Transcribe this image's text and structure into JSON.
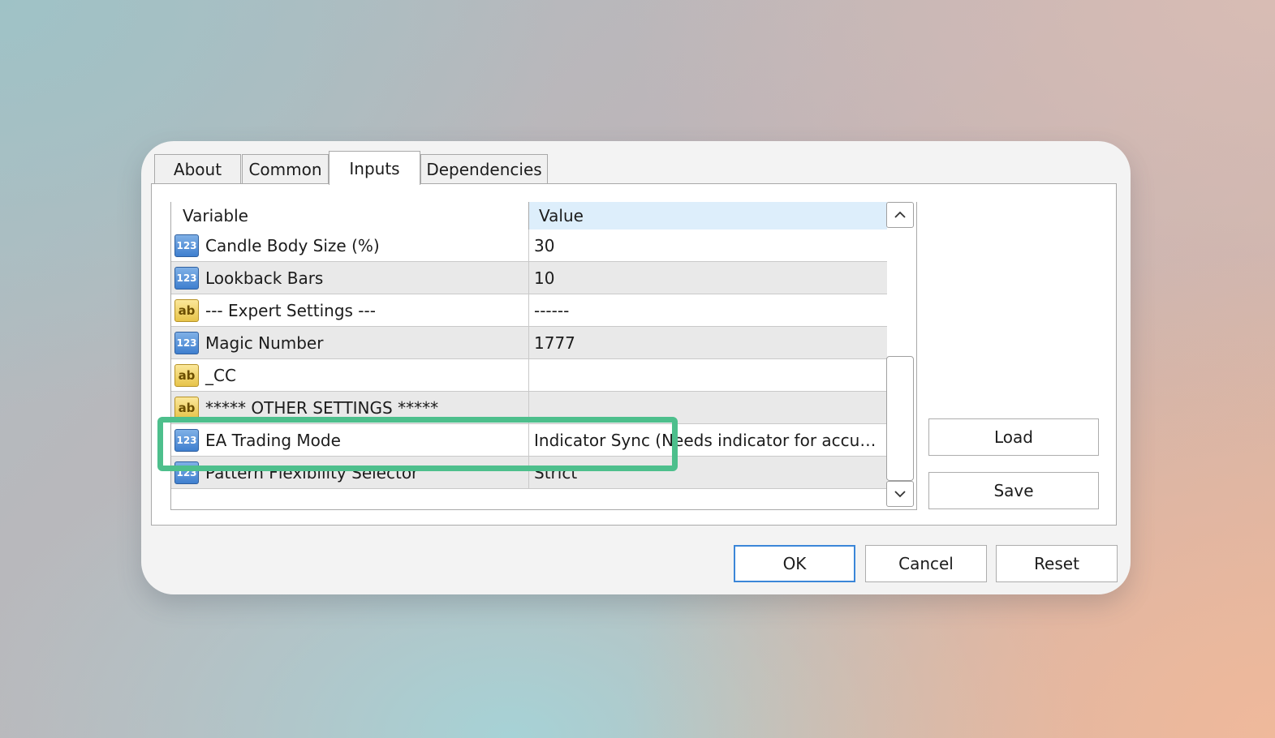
{
  "tabs": [
    {
      "label": "About"
    },
    {
      "label": "Common"
    },
    {
      "label": "Inputs",
      "active": true
    },
    {
      "label": "Dependencies"
    }
  ],
  "grid": {
    "headers": {
      "variable": "Variable",
      "value": "Value"
    },
    "rows": [
      {
        "icon": "123",
        "type": "num",
        "variable": "Candle Body Size (%)",
        "value": "30"
      },
      {
        "icon": "123",
        "type": "num",
        "variable": "Lookback Bars",
        "value": "10"
      },
      {
        "icon": "ab",
        "type": "str",
        "variable": "--- Expert Settings ---",
        "value": "------"
      },
      {
        "icon": "123",
        "type": "num",
        "variable": "Magic Number",
        "value": "1777"
      },
      {
        "icon": "ab",
        "type": "str",
        "variable": "_CC",
        "value": ""
      },
      {
        "icon": "ab",
        "type": "str",
        "variable": "***** OTHER SETTINGS *****",
        "value": ""
      },
      {
        "icon": "123",
        "type": "num",
        "variable": "EA Trading Mode",
        "value": "Indicator Sync (Needs indicator for accuracy)"
      },
      {
        "icon": "123",
        "type": "num",
        "variable": "Pattern Flexibility Selector",
        "value": "Strict"
      }
    ]
  },
  "buttons": {
    "load": "Load",
    "save": "Save",
    "ok": "OK",
    "cancel": "Cancel",
    "reset": "Reset"
  },
  "highlight_color": "#4dbf8c",
  "accent_color": "#3b86d8"
}
